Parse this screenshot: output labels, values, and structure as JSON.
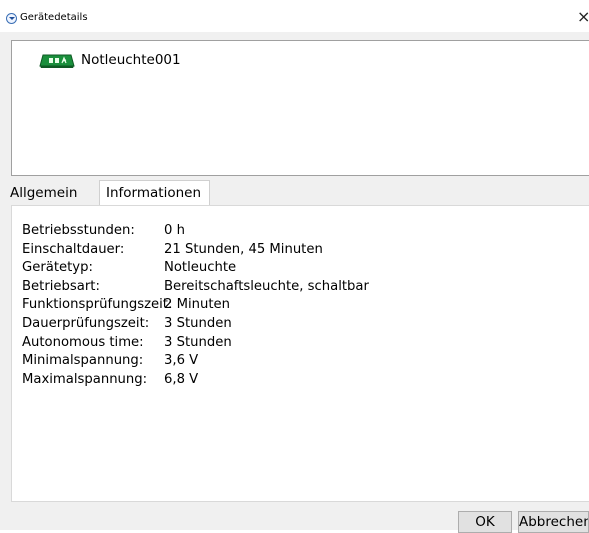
{
  "window": {
    "title": "Gerätedetails",
    "close_glyph": "×",
    "icon": "dropdown-circle-icon"
  },
  "device_list": {
    "items": [
      {
        "name": "Notleuchte001",
        "icon": "emergency-exit-light-icon",
        "icon_color": "#1a8f3c"
      }
    ]
  },
  "tabs": [
    {
      "label": "Allgemein",
      "selected": false
    },
    {
      "label": "Informationen",
      "selected": true
    }
  ],
  "info": {
    "rows": [
      {
        "label": "Betriebsstunden:",
        "value": "0 h"
      },
      {
        "label": "Einschaltdauer:",
        "value": "21 Stunden, 45 Minuten"
      },
      {
        "label": "Gerätetyp:",
        "value": "Notleuchte"
      },
      {
        "label": "Betriebsart:",
        "value": "Bereitschaftsleuchte, schaltbar"
      },
      {
        "label": "Funktionsprüfungszeit:",
        "value": "2 Minuten"
      },
      {
        "label": "Dauerprüfungszeit:",
        "value": "3 Stunden"
      },
      {
        "label": "Autonomous time:",
        "value": "3 Stunden"
      },
      {
        "label": "Minimalspannung:",
        "value": "3,6 V"
      },
      {
        "label": "Maximalspannung:",
        "value": "6,8 V"
      }
    ]
  },
  "buttons": {
    "ok": "OK",
    "cancel": "Abbrechen"
  },
  "colors": {
    "dialog_bg": "#f0f0f0",
    "panel_bg": "#ffffff",
    "button_bg": "#e1e1e1"
  }
}
